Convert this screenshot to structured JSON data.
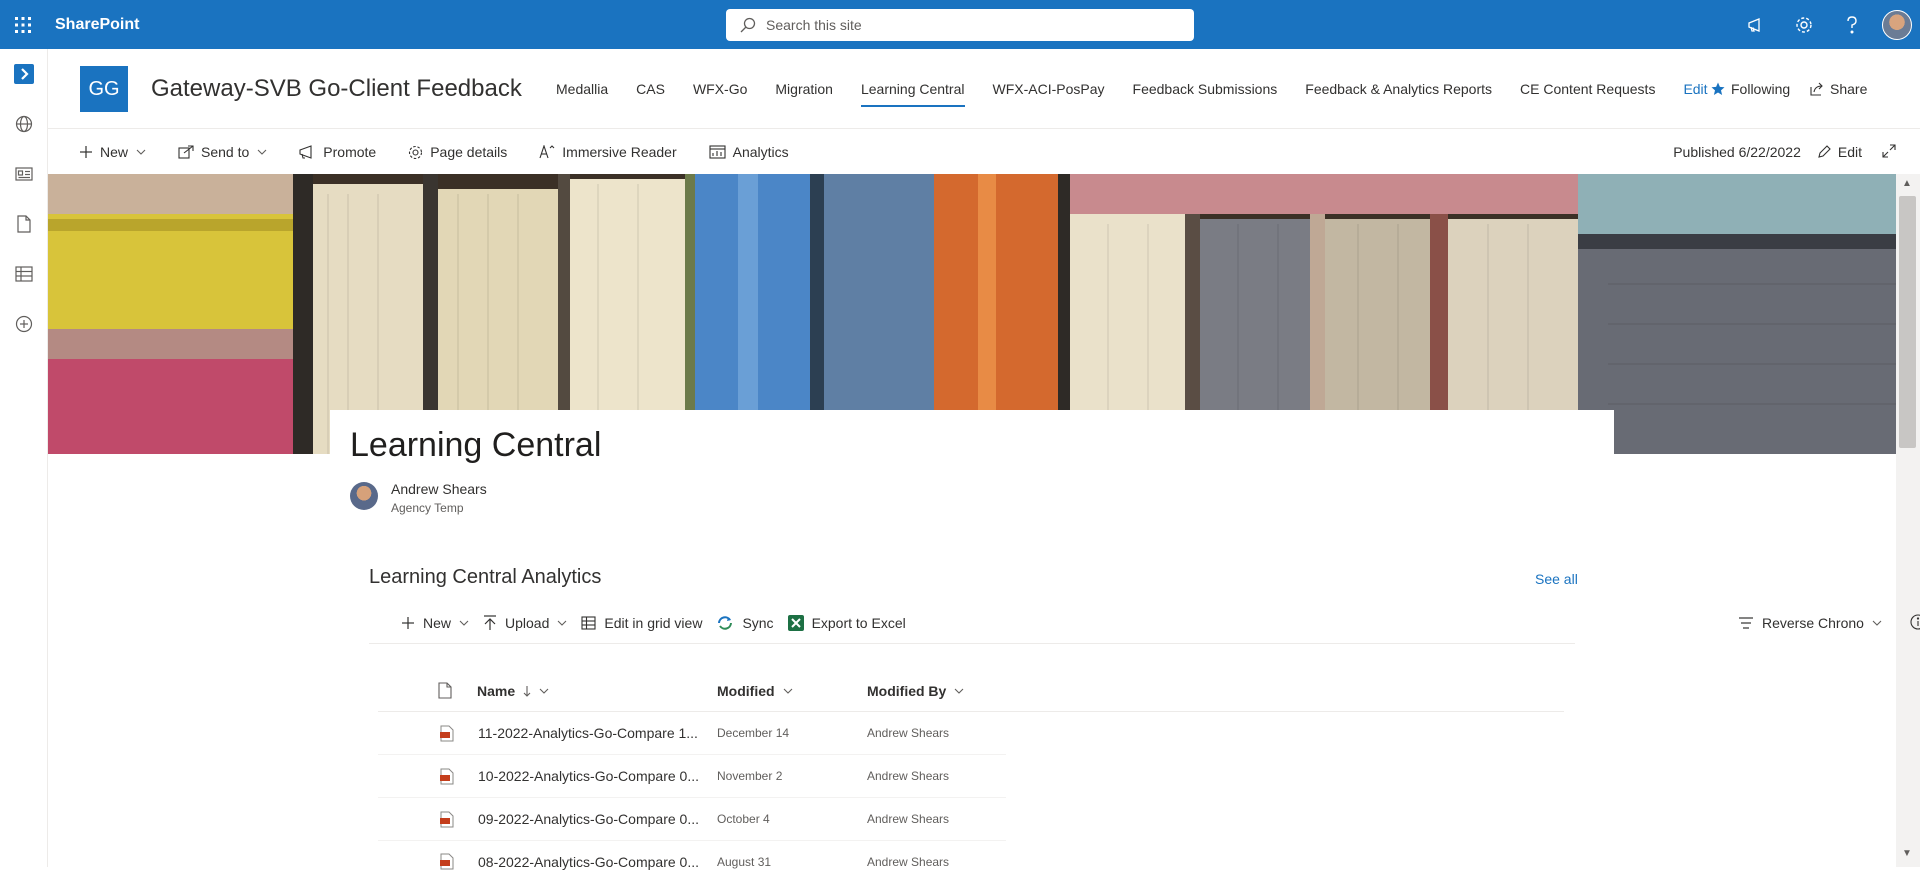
{
  "suite": {
    "brand": "SharePoint",
    "search_placeholder": "Search this site"
  },
  "site": {
    "logo_initials": "GG",
    "title": "Gateway-SVB Go-Client Feedback",
    "nav": [
      {
        "label": "Medallia"
      },
      {
        "label": "CAS"
      },
      {
        "label": "WFX-Go"
      },
      {
        "label": "Migration"
      },
      {
        "label": "Learning Central",
        "active": true
      },
      {
        "label": "WFX-ACI-PosPay"
      },
      {
        "label": "Feedback Submissions"
      },
      {
        "label": "Feedback & Analytics Reports"
      },
      {
        "label": "CE Content Requests"
      }
    ],
    "nav_edit": "Edit",
    "following": "Following",
    "share": "Share"
  },
  "commandbar": {
    "new": "New",
    "send_to": "Send to",
    "promote": "Promote",
    "page_details": "Page details",
    "immersive_reader": "Immersive Reader",
    "analytics": "Analytics",
    "published": "Published 6/22/2022",
    "edit": "Edit"
  },
  "page": {
    "title": "Learning Central",
    "author_name": "Andrew Shears",
    "author_role": "Agency Temp"
  },
  "library": {
    "title": "Learning Central Analytics",
    "see_all": "See all",
    "cmd": {
      "new": "New",
      "upload": "Upload",
      "edit_grid": "Edit in grid view",
      "sync": "Sync",
      "export": "Export to Excel",
      "view": "Reverse Chrono"
    },
    "columns": {
      "name": "Name",
      "modified": "Modified",
      "modified_by": "Modified By"
    },
    "rows": [
      {
        "name": "11-2022-Analytics-Go-Compare 1...",
        "modified": "December 14",
        "by": "Andrew Shears"
      },
      {
        "name": "10-2022-Analytics-Go-Compare 0...",
        "modified": "November 2",
        "by": "Andrew Shears"
      },
      {
        "name": "09-2022-Analytics-Go-Compare 0...",
        "modified": "October 4",
        "by": "Andrew Shears"
      },
      {
        "name": "08-2022-Analytics-Go-Compare 0...",
        "modified": "August 31",
        "by": "Andrew Shears"
      }
    ]
  },
  "colors": {
    "accent": "#1a73c0"
  }
}
